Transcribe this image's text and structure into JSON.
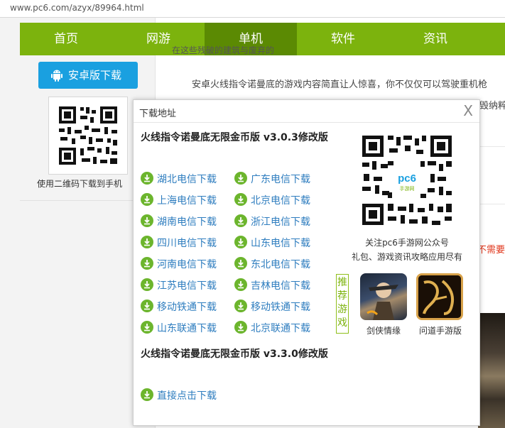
{
  "browser": {
    "url": "www.pc6.com/azyx/89964.html"
  },
  "nav": {
    "items": [
      "首页",
      "网游",
      "单机",
      "软件",
      "资讯"
    ],
    "active": "单机"
  },
  "sidebar": {
    "android_button": "安卓版下载",
    "qr_caption": "使用二维码下载到手机"
  },
  "content": {
    "top_fragment": "在这些残破的建筑与废弃的",
    "description": "安卓火线指令诺曼底的游戏内容简直让人惊喜，你不仅仅可以驾驶重机枪",
    "description_tail": "毁纳粹",
    "red_fragment": "不需要"
  },
  "modal": {
    "title": "下载地址",
    "close": "X",
    "version1": "火线指令诺曼底无限金币版 v3.0.3修改版",
    "links_left": [
      "湖北电信下载",
      "上海电信下载",
      "湖南电信下载",
      "四川电信下载",
      "河南电信下载",
      "江苏电信下载",
      "移动铁通下载",
      "山东联通下载"
    ],
    "links_right": [
      "广东电信下载",
      "北京电信下载",
      "浙江电信下载",
      "山东电信下载",
      "东北电信下载",
      "吉林电信下载",
      "移动铁通下载",
      "北京联通下载"
    ],
    "version2": "火线指令诺曼底无限金币版 v3.3.0修改版",
    "direct_link": "直接点击下载",
    "qr_logo_text": "pc6",
    "qr_logo_sub": "手游网",
    "follow_line1": "关注pc6手游网公众号",
    "follow_line2": "礼包、游戏资讯攻略应用尽有",
    "recommend_label": "推荐游戏",
    "games": [
      {
        "name": "剑侠情缘"
      },
      {
        "name": "问道手游版"
      }
    ]
  },
  "colors": {
    "nav_green": "#7cb30d",
    "nav_active": "#5b8a03",
    "android_blue": "#1aa0e0",
    "link_blue": "#2e7dbf",
    "icon_green": "#6cb52d"
  }
}
